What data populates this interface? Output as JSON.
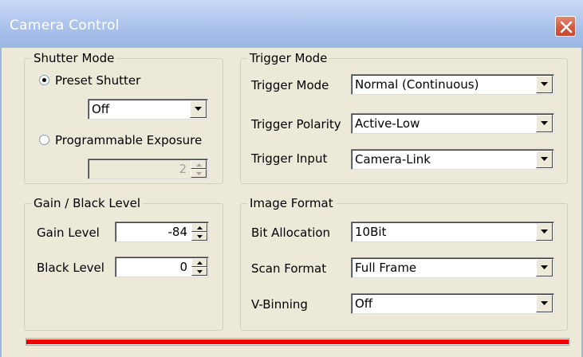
{
  "window": {
    "title": "Camera Control"
  },
  "shutter": {
    "group_label": "Shutter Mode",
    "preset_label": "Preset Shutter",
    "preset_selected": true,
    "preset_value": "Off",
    "programmable_label": "Programmable Exposure",
    "programmable_value": "2"
  },
  "gain": {
    "group_label": "Gain / Black Level",
    "gain_label": "Gain Level",
    "gain_value": "-84",
    "black_label": "Black Level",
    "black_value": "0"
  },
  "trigger": {
    "group_label": "Trigger Mode",
    "mode_label": "Trigger Mode",
    "mode_value": "Normal (Continuous)",
    "polarity_label": "Trigger Polarity",
    "polarity_value": "Active-Low",
    "input_label": "Trigger Input",
    "input_value": "Camera-Link"
  },
  "image_format": {
    "group_label": "Image Format",
    "bit_label": "Bit Allocation",
    "bit_value": "10Bit",
    "scan_label": "Scan Format",
    "scan_value": "Full Frame",
    "vbin_label": "V-Binning",
    "vbin_value": "Off"
  },
  "status": {
    "progress": 1.0,
    "progress_color": "#f00000"
  },
  "icons": {
    "close": "close-icon",
    "dropdown": "chevron-down-icon",
    "spin_up": "spin-up-icon",
    "spin_down": "spin-down-icon"
  }
}
